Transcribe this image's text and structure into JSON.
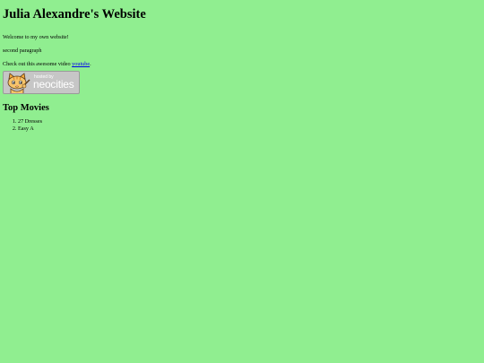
{
  "page": {
    "background_color": "#90ee90",
    "title": "Julia Alexandre's Website",
    "paragraphs": {
      "welcome": "Welcome to my own website!",
      "second": "second paragraph",
      "video_prefix": "Check out this awesome video ",
      "video_link": "youtube",
      "video_suffix": "."
    },
    "badge": {
      "icon": "neocities-cat-icon",
      "small_text": "hosted by",
      "big_text": "neocities"
    },
    "movies": {
      "heading": "Top Movies",
      "items": [
        "27 Dresses",
        "Easy A"
      ]
    },
    "link_color": "#0000ee"
  }
}
